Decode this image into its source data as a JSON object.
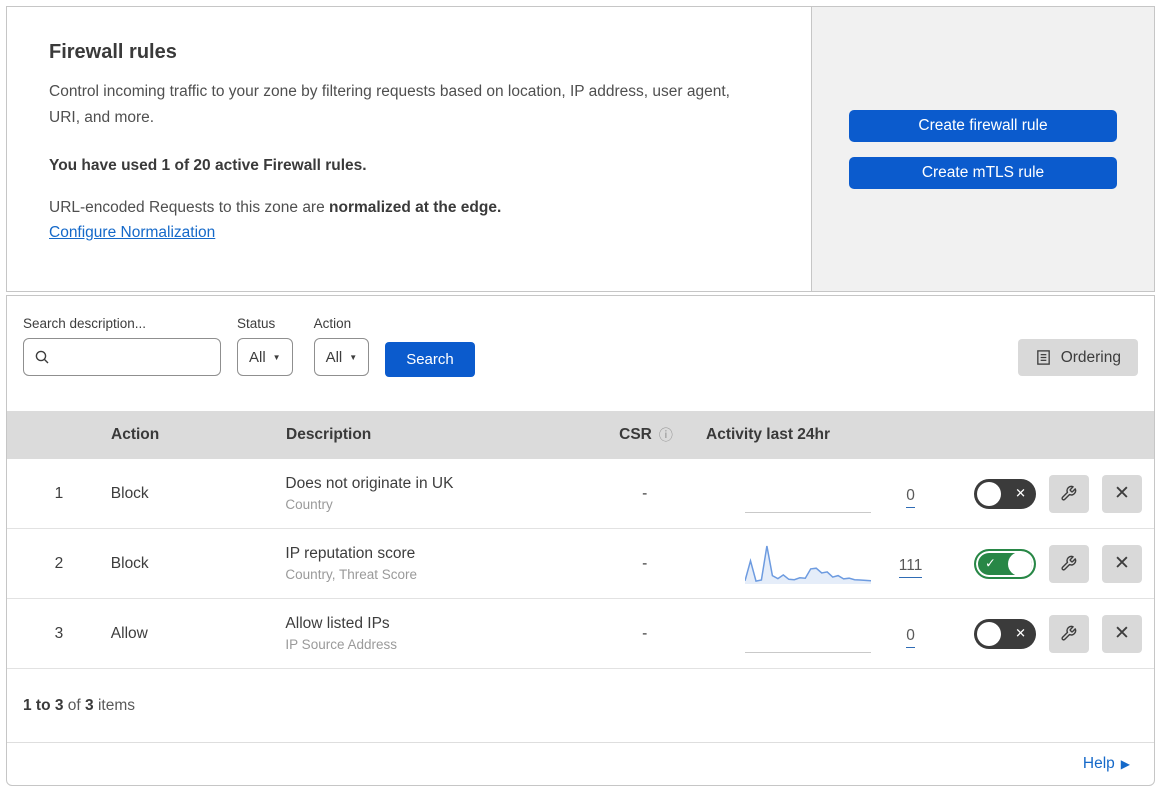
{
  "header": {
    "title": "Firewall rules",
    "description": "Control incoming traffic to your zone by filtering requests based on location, IP address, user agent, URI, and more.",
    "usage_bold": "You have used 1 of 20 active Firewall rules.",
    "normalization_text": "URL-encoded Requests to this zone are ",
    "normalization_bold": "normalized at the edge.",
    "configure_link": "Configure Normalization",
    "create_firewall_button": "Create firewall rule",
    "create_mtls_button": "Create mTLS rule"
  },
  "filters": {
    "search_label": "Search description...",
    "status_label": "Status",
    "status_value": "All",
    "action_label": "Action",
    "action_value": "All",
    "search_button": "Search",
    "ordering_button": "Ordering"
  },
  "table": {
    "columns": {
      "action": "Action",
      "description": "Description",
      "csr": "CSR",
      "activity": "Activity last 24hr"
    },
    "rows": [
      {
        "number": "1",
        "action": "Block",
        "description": "Does not originate in UK",
        "fields": "Country",
        "csr": "-",
        "activity_count": "0",
        "enabled": false,
        "sparkline": null
      },
      {
        "number": "2",
        "action": "Block",
        "description": "IP reputation score",
        "fields": "Country, Threat Score",
        "csr": "-",
        "activity_count": "111",
        "enabled": true,
        "sparkline": [
          6,
          60,
          5,
          8,
          100,
          20,
          12,
          22,
          10,
          9,
          14,
          13,
          38,
          40,
          27,
          30,
          16,
          20,
          11,
          13,
          9,
          8,
          7,
          6
        ]
      },
      {
        "number": "3",
        "action": "Allow",
        "description": "Allow listed IPs",
        "fields": "IP Source Address",
        "csr": "-",
        "activity_count": "0",
        "enabled": false,
        "sparkline": null
      }
    ]
  },
  "footer": {
    "range_bold": "1 to 3",
    "of_text": "of",
    "total_bold": "3",
    "items_text": "items",
    "help_label": "Help"
  },
  "icons": {
    "check": "✓",
    "cross": "✕",
    "close": "✕",
    "caret_down": "▼",
    "help_arrow": "▶",
    "info": "ⓘ"
  },
  "colors": {
    "accent_blue": "#0b5bcd",
    "link_blue": "#1569c9",
    "toggle_on_green": "#288746",
    "toggle_off_gray": "#3b3b3b",
    "sparkline": "#6d9be0",
    "header_bg": "#dbdbdb",
    "panel_bg": "#f1f1f1"
  }
}
